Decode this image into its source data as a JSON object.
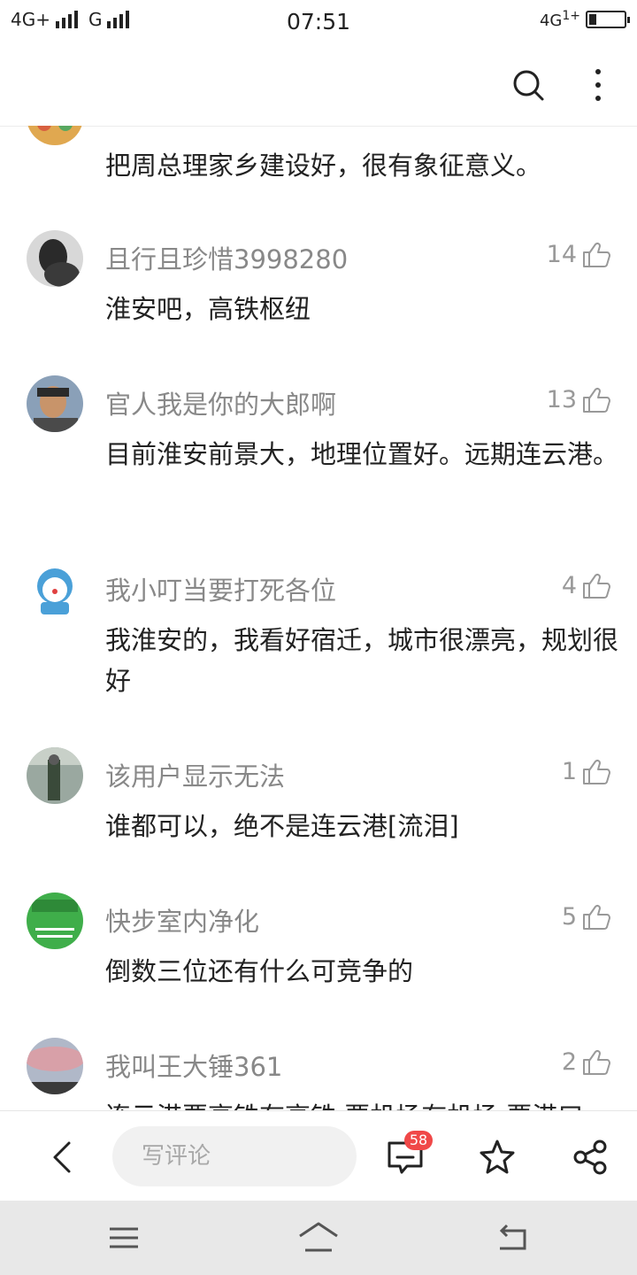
{
  "status_bar": {
    "network_left_1": "4G+",
    "network_left_2": "G",
    "time": "07:51",
    "network_right": "4G",
    "network_right_sub": "1+"
  },
  "header": {
    "search_icon": "search-icon",
    "more_icon": "more-vertical-icon"
  },
  "comments": [
    {
      "username": "",
      "likes": "",
      "text": "把周总理家乡建设好，很有象征意义。",
      "avatar_color": "#e0a850"
    },
    {
      "username": "且行且珍惜3998280",
      "likes": "14",
      "text": "淮安吧，高铁枢纽",
      "avatar_color": "#3a3a3a"
    },
    {
      "username": "官人我是你的大郎啊",
      "likes": "13",
      "text": "目前淮安前景大，地理位置好。远期连云港。",
      "avatar_color": "#6a5a4a"
    },
    {
      "username": "我小叮当要打死各位",
      "likes": "4",
      "text": "我淮安的，我看好宿迁，城市很漂亮，规划很好",
      "avatar_color": "#4aa0d8"
    },
    {
      "username": "该用户显示无法",
      "likes": "1",
      "text": "谁都可以，绝不是连云港[流泪]",
      "avatar_color": "#5a6a5a"
    },
    {
      "username": "快步室内净化",
      "likes": "5",
      "text": "倒数三位还有什么可竞争的",
      "avatar_color": "#3fae4a"
    },
    {
      "username": "我叫王大锤361",
      "likes": "2",
      "text": "连云港要高铁有高铁 要机场有机场 要港口",
      "avatar_color": "#b89aa8"
    }
  ],
  "bottom_bar": {
    "input_placeholder": "写评论",
    "comment_count": "58"
  },
  "colors": {
    "badge": "#f04848",
    "nav_bar": "#e8e8e8"
  }
}
